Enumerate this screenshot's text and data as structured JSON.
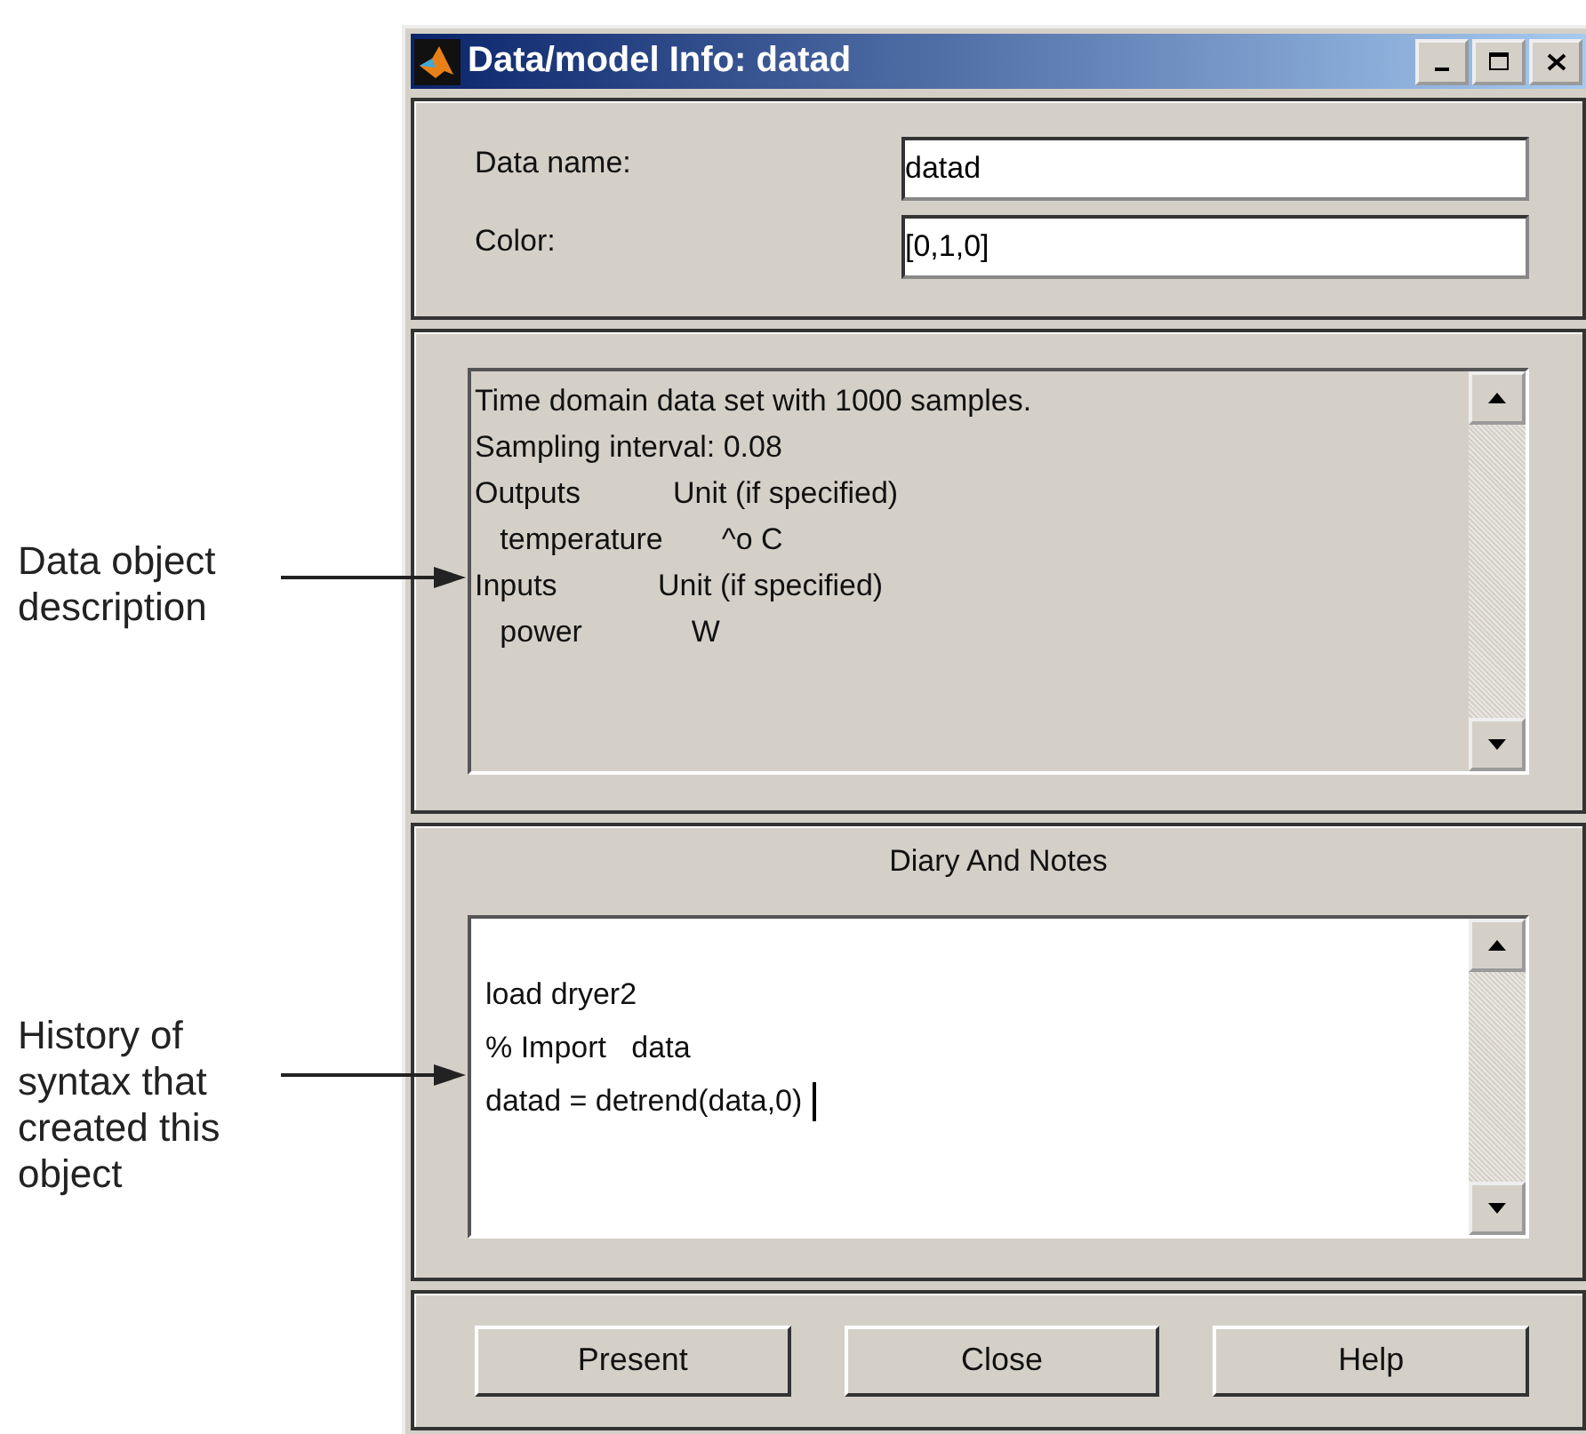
{
  "annotations": [
    {
      "text": "Data object description"
    },
    {
      "text": "History of syntax that created this object"
    }
  ],
  "window": {
    "title": "Data/model Info: datad"
  },
  "fields": [
    {
      "label": "Data name:",
      "value": "datad"
    },
    {
      "label": "Color:",
      "value": "[0,1,0]"
    }
  ],
  "description": {
    "lines": [
      "Time domain data set with 1000 samples.",
      "Sampling interval: 0.08",
      "Outputs           Unit (if specified)",
      "   temperature       ^o C",
      "Inputs            Unit (if specified)",
      "   power             W"
    ]
  },
  "diary": {
    "title": "Diary And Notes",
    "lines": [
      {
        "text": "load dryer2",
        "cursor": false
      },
      {
        "text": "% Import   data",
        "cursor": false
      },
      {
        "text": "datad = detrend(data,0)",
        "cursor": true
      }
    ]
  },
  "buttons": [
    "Present",
    "Close",
    "Help"
  ]
}
